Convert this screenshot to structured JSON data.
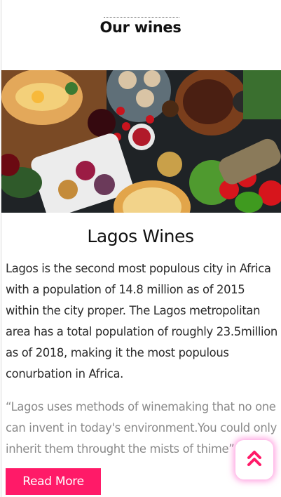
{
  "section": {
    "title": "Our wines"
  },
  "hero": {
    "alt": "Table spread of food and wine",
    "icon": "food-photo"
  },
  "card": {
    "title": "Lagos Wines",
    "body": "Lagos is the second most populous city in Africa with a population of 14.8 million as of 2015 within the city proper. The Lagos metropolitan area has a total population of roughly 23.5million as of 2018, making it the most populous conurbation in Africa.",
    "quote": "“Lagos uses methods of winemaking that no one can invent in today's environment.You could only inherit them throught the mists of thime”",
    "read_more_label": "Read More"
  },
  "scroll_top": {
    "icon": "double-chevron-up-icon",
    "label": "Scroll to top"
  },
  "colors": {
    "accent": "#ff1a68",
    "glow": "#ff5ac8",
    "quote_text": "#8a8a8a"
  }
}
